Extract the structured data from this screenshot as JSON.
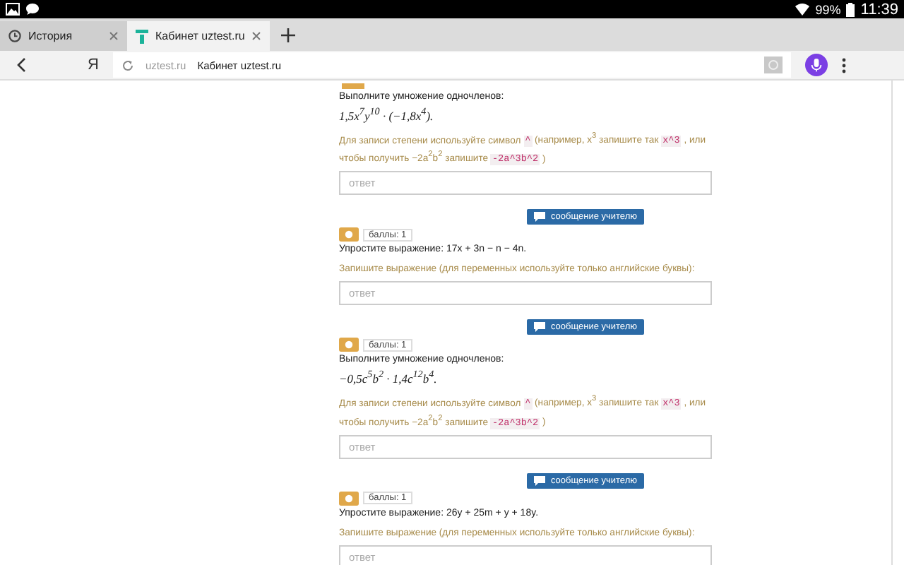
{
  "status_bar": {
    "battery": "99%",
    "time": "11:39"
  },
  "tabs": [
    {
      "label": "История",
      "selected": false,
      "kind": "history"
    },
    {
      "label": "Кабинет uztest.ru",
      "selected": true,
      "kind": "site"
    }
  ],
  "address_bar": {
    "domain": "uztest.ru",
    "title": "Кабинет uztest.ru",
    "letter": "Я"
  },
  "questions": [
    {
      "prompt": "Выполните умножение одночленов:",
      "formula": "1,5x$^{7}$y$^{10}$ · (−1,8x$^{4}$).",
      "hint": [
        {
          "kind": "text",
          "text": "Для записи степени используйте символ"
        },
        {
          "kind": "code",
          "text": "^"
        },
        {
          "kind": "text",
          "text": "(например, x$^{3}$ запишите так"
        },
        {
          "kind": "code",
          "text": "x^3"
        },
        {
          "kind": "text",
          "text": ", или чтобы получить −2a$^{2}$b$^{2}$ запишите"
        },
        {
          "kind": "code",
          "text": "-2a^3b^2"
        },
        {
          "kind": "text",
          "text": ")"
        }
      ],
      "placeholder": "ответ"
    },
    {
      "points": "баллы: 1",
      "prompt": "Упростите выражение: 17x + 3n − n − 4n.",
      "hint": [
        {
          "kind": "text",
          "text": "Запишите выражение (для переменных используйте только английские буквы):"
        }
      ],
      "placeholder": "ответ",
      "message_button": "сообщение учителю"
    },
    {
      "points": "баллы: 1",
      "prompt": "Выполните умножение одночленов:",
      "formula": "−0,5c$^{5}$b$^{2}$ · 1,4c$^{12}$b$^{4}$.",
      "hint": [
        {
          "kind": "text",
          "text": "Для записи степени используйте символ"
        },
        {
          "kind": "code",
          "text": "^"
        },
        {
          "kind": "text",
          "text": "(например, x$^{3}$ запишите так"
        },
        {
          "kind": "code",
          "text": "x^3"
        },
        {
          "kind": "text",
          "text": ", или чтобы получить −2a$^{2}$b$^{2}$ запишите"
        },
        {
          "kind": "code",
          "text": "-2a^3b^2"
        },
        {
          "kind": "text",
          "text": ")"
        }
      ],
      "placeholder": "ответ",
      "message_button": "сообщение учителю"
    },
    {
      "points": "баллы: 1",
      "prompt": "Упростите выражение: 26y + 25m + y + 18y.",
      "hint": [
        {
          "kind": "text",
          "text": "Запишите выражение (для переменных используйте только английские буквы):"
        }
      ],
      "placeholder": "ответ",
      "message_button": "сообщение учителю"
    }
  ]
}
